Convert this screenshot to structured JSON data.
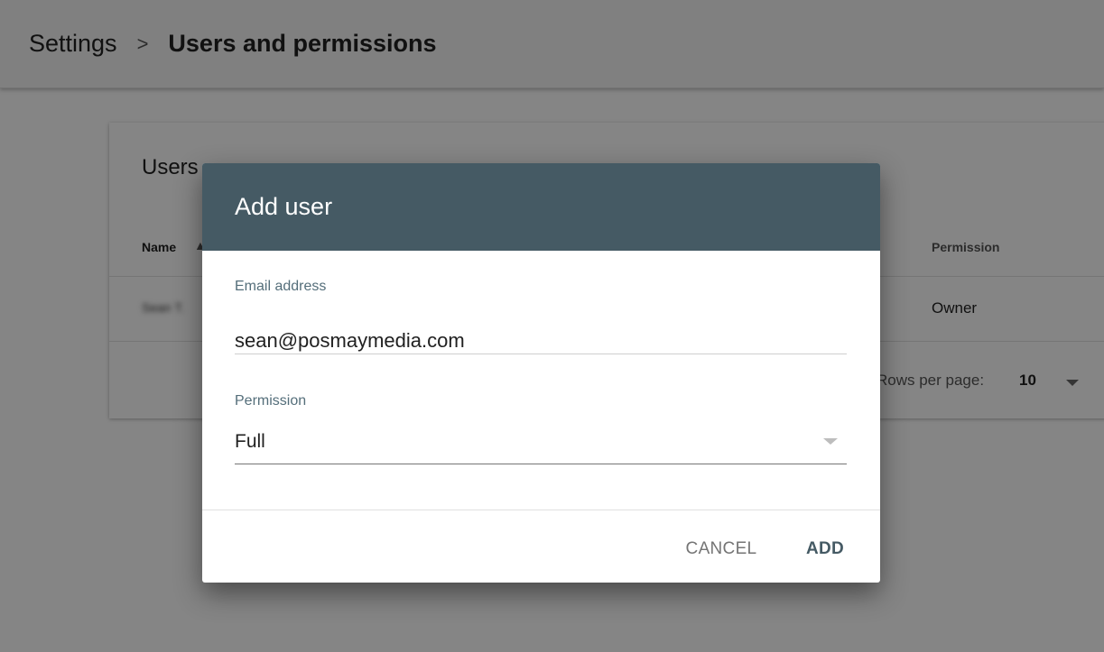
{
  "breadcrumb": {
    "parent": "Settings",
    "separator": ">",
    "current": "Users and permissions"
  },
  "users_card": {
    "title": "Users",
    "columns": {
      "name": "Name",
      "permission": "Permission"
    },
    "rows": [
      {
        "name": "Sean T.",
        "permission": "Owner"
      }
    ],
    "pagination": {
      "rows_per_page_label": "Rows per page:",
      "rows_per_page_value": "10"
    }
  },
  "dialog": {
    "title": "Add user",
    "email": {
      "label": "Email address",
      "value": "sean@posmaymedia.com"
    },
    "permission": {
      "label": "Permission",
      "value": "Full"
    },
    "buttons": {
      "cancel": "CANCEL",
      "add": "ADD"
    }
  },
  "colors": {
    "dialog_header": "#455a64",
    "primary_button": "#455a64",
    "scrim": "rgba(0,0,0,0.48)"
  },
  "icons": {
    "breadcrumb_separator": "chevron-right-icon",
    "sort": "sort-arrow-icon",
    "dropdown": "caret-down-icon"
  }
}
